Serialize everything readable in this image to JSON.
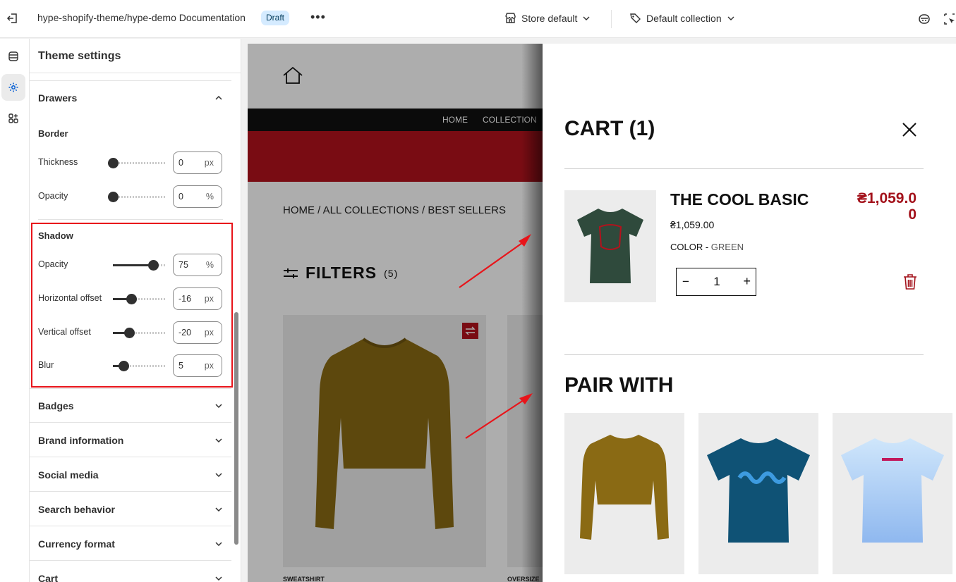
{
  "topbar": {
    "title": "hype-shopify-theme/hype-demo Documentation",
    "badge": "Draft",
    "more": "•••",
    "store": "Store default",
    "collection": "Default collection"
  },
  "panel": {
    "title": "Theme settings",
    "drawers": "Drawers",
    "border": {
      "title": "Border",
      "thickness": {
        "label": "Thickness",
        "value": "0",
        "unit": "px",
        "fraction": 0.0
      },
      "opacity": {
        "label": "Opacity",
        "value": "0",
        "unit": "%",
        "fraction": 0.0
      }
    },
    "shadow": {
      "title": "Shadow",
      "opacity": {
        "label": "Opacity",
        "value": "75",
        "unit": "%",
        "fraction": 0.75
      },
      "horizontal": {
        "label": "Horizontal offset",
        "value": "-16",
        "unit": "px",
        "fraction": 0.34
      },
      "vertical": {
        "label": "Vertical offset",
        "value": "-20",
        "unit": "px",
        "fraction": 0.3
      },
      "blur": {
        "label": "Blur",
        "value": "5",
        "unit": "px",
        "fraction": 0.2
      }
    },
    "sections": [
      "Badges",
      "Brand information",
      "Social media",
      "Search behavior",
      "Currency format",
      "Cart"
    ]
  },
  "store": {
    "nav": [
      "HOME",
      "COLLECTION"
    ],
    "breadcrumb_prefix": "HOME / ALL COLLECTIONS / ",
    "breadcrumb_current": "BEST SELLERS",
    "filters_label": "FILTERS",
    "filters_count": "(5)",
    "cards": [
      "SWEATSHIRT",
      "OVERSIZE"
    ]
  },
  "cart": {
    "title": "CART (1)",
    "item": {
      "name": "THE COOL BASIC",
      "price": "₴1,059.00",
      "color_label": "COLOR - ",
      "color_value": "GREEN",
      "total_line1": "₴1,059.0",
      "total_line2": "0",
      "quantity": "1",
      "minus": "−",
      "plus": "+"
    },
    "pair_title": "PAIR WITH"
  },
  "colors": {
    "accent_red": "#a3121b",
    "annotation_red": "#e8141a",
    "draft_badge": "#d5ebff",
    "shirt_green": "#2f4a3c",
    "sweatshirt": "#8a6a14",
    "navy_tee": "#0f5275",
    "light_blue_tee": "#a9cdf1"
  }
}
